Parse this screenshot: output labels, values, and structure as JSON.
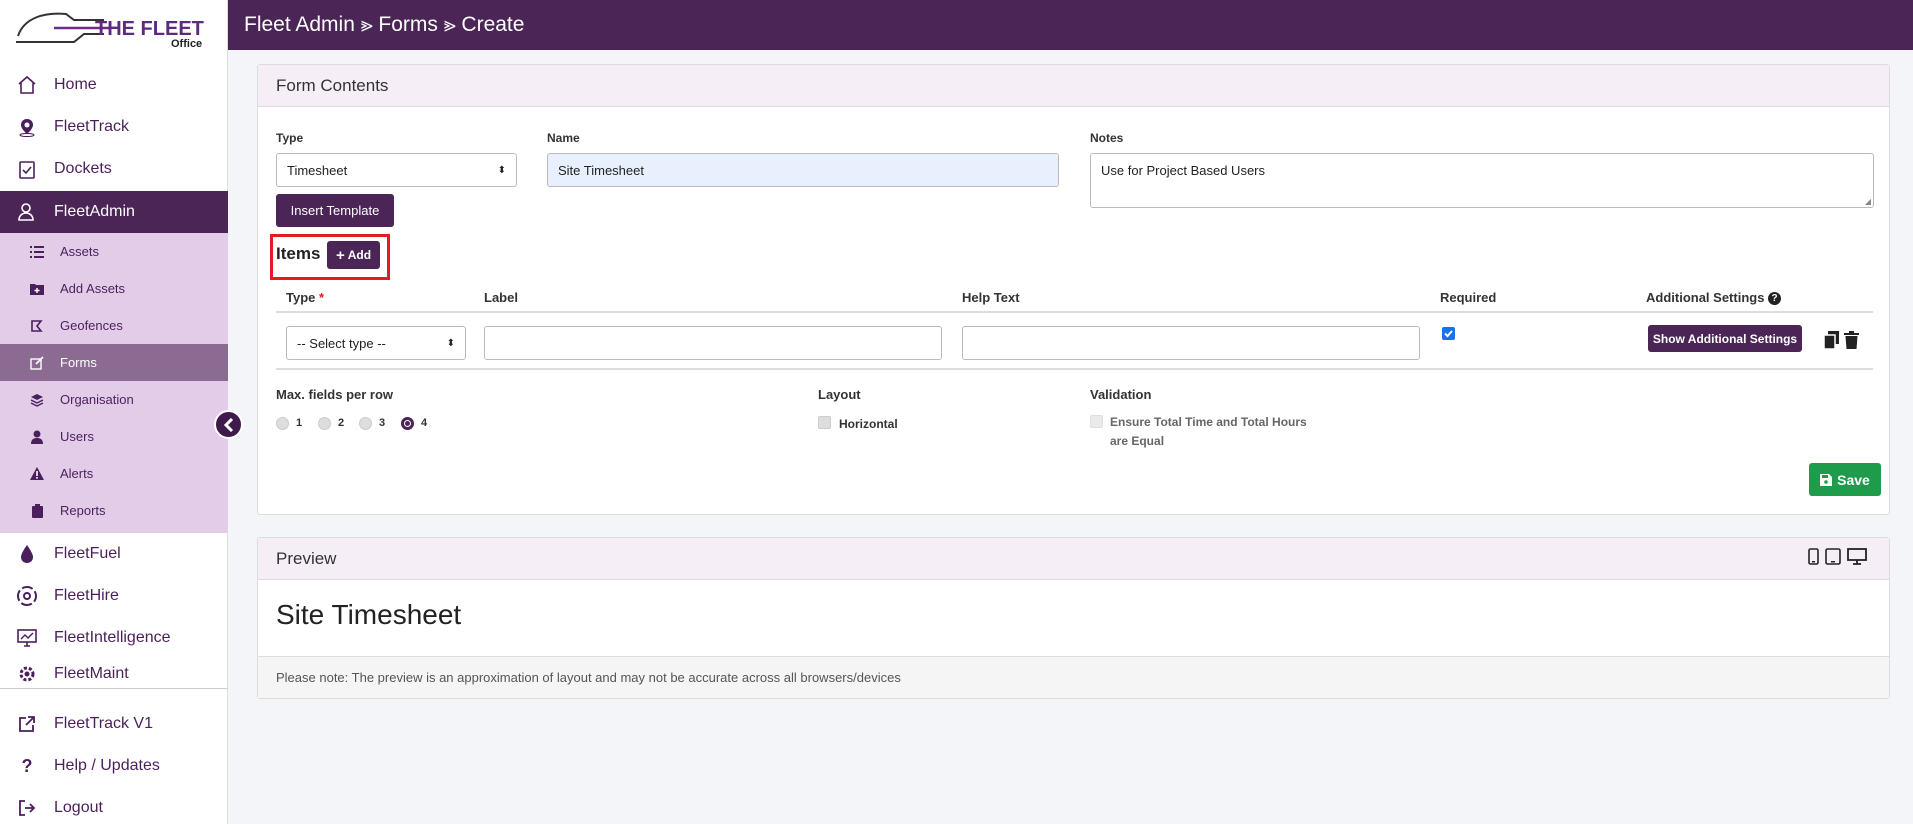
{
  "brand": {
    "line1": "THE FLEET",
    "line2": "Office"
  },
  "header": {
    "breadcrumb": "Fleet Admin ⪢ Forms ⪢ Create"
  },
  "sidebar": {
    "items": [
      {
        "label": "Home",
        "icon": "home-icon"
      },
      {
        "label": "FleetTrack",
        "icon": "map-pin-icon"
      },
      {
        "label": "Dockets",
        "icon": "clipboard-check-icon"
      },
      {
        "label": "FleetAdmin",
        "icon": "user-gear-icon",
        "active": true
      },
      {
        "label": "FleetFuel",
        "icon": "fuel-drop-icon"
      },
      {
        "label": "FleetHire",
        "icon": "hire-swirl-icon"
      },
      {
        "label": "FleetIntelligence",
        "icon": "monitor-chart-icon"
      },
      {
        "label": "FleetMaint",
        "icon": "gear-cog-icon"
      },
      {
        "label": "FleetTrack V1",
        "icon": "external-link-icon"
      },
      {
        "label": "Help / Updates",
        "icon": "question-icon"
      },
      {
        "label": "Logout",
        "icon": "sign-out-icon"
      }
    ],
    "sub_items": [
      {
        "label": "Assets",
        "icon": "list-icon"
      },
      {
        "label": "Add Assets",
        "icon": "folder-plus-icon"
      },
      {
        "label": "Geofences",
        "icon": "geofence-icon"
      },
      {
        "label": "Forms",
        "icon": "edit-icon",
        "active": true
      },
      {
        "label": "Organisation",
        "icon": "layers-icon"
      },
      {
        "label": "Users",
        "icon": "user-icon"
      },
      {
        "label": "Alerts",
        "icon": "warning-icon"
      },
      {
        "label": "Reports",
        "icon": "clipboard-icon"
      }
    ]
  },
  "form": {
    "section_title": "Form Contents",
    "type_label": "Type",
    "type_value": "Timesheet",
    "name_label": "Name",
    "name_value": "Site Timesheet",
    "notes_label": "Notes",
    "notes_value": "Use for Project Based Users",
    "insert_template": "Insert Template",
    "items_title": "Items",
    "add_label": "Add",
    "columns": {
      "type": "Type",
      "required_mark": "*",
      "label": "Label",
      "help": "Help Text",
      "required": "Required",
      "additional": "Additional Settings"
    },
    "row": {
      "type_placeholder": "-- Select type --",
      "label_value": "",
      "help_value": "",
      "required_checked": true,
      "show_settings": "Show Additional Settings"
    },
    "max_fields_label": "Max. fields per row",
    "max_fields_options": [
      "1",
      "2",
      "3",
      "4"
    ],
    "max_fields_selected": "4",
    "layout_label": "Layout",
    "layout_option": "Horizontal",
    "validation_label": "Validation",
    "validation_line1": "Ensure Total Time and Total Hours",
    "validation_line2": "are Equal",
    "save": "Save"
  },
  "preview": {
    "title": "Preview",
    "form_name": "Site Timesheet",
    "note": "Please note: The preview is an approximation of layout and may not be accurate across all browsers/devices"
  },
  "colors": {
    "primary": "#4b2556",
    "submenu": "#e3cce8",
    "save": "#1e9b4b",
    "highlight": "#e31b23"
  }
}
